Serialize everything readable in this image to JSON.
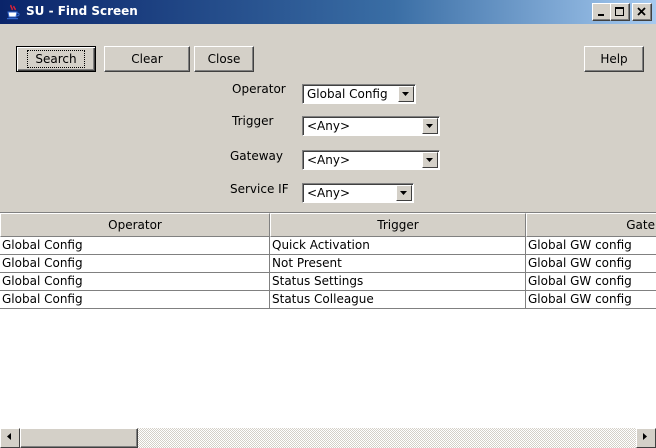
{
  "window": {
    "title": "SU - Find Screen",
    "icon": "java-cup-icon",
    "controls": [
      "minimize",
      "maximize",
      "close"
    ]
  },
  "toolbar": {
    "search_label": "Search",
    "clear_label": "Clear",
    "close_label": "Close",
    "help_label": "Help"
  },
  "filters": {
    "operator": {
      "label": "Operator",
      "value": "Global Config"
    },
    "trigger": {
      "label": "Trigger",
      "value": "<Any>"
    },
    "gateway": {
      "label": "Gateway",
      "value": "<Any>"
    },
    "service_if": {
      "label": "Service IF",
      "value": "<Any>"
    }
  },
  "table": {
    "columns": [
      "Operator",
      "Trigger",
      "Gate"
    ],
    "rows": [
      [
        "Global Config",
        "Quick Activation",
        "Global GW config"
      ],
      [
        "Global Config",
        "Not Present",
        "Global GW config"
      ],
      [
        "Global Config",
        "Status Settings",
        "Global GW config"
      ],
      [
        "Global Config",
        "Status Colleague",
        "Global GW config"
      ]
    ]
  },
  "colors": {
    "titlebar_start": "#0a246a",
    "titlebar_end": "#a6caf0",
    "face": "#d4d0c8"
  }
}
